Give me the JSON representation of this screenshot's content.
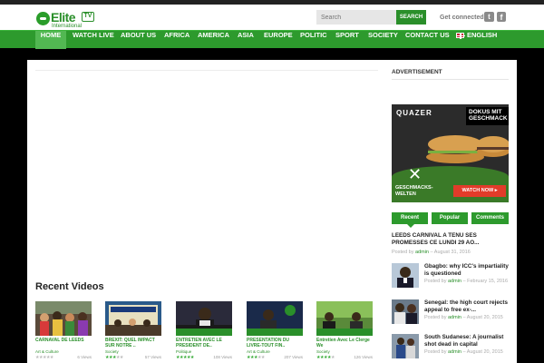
{
  "header": {
    "logo_text": "Elite",
    "logo_tv": "TV",
    "logo_sub": "International",
    "search_placeholder": "Search",
    "search_button": "SEARCH",
    "get_connected": "Get connected:",
    "twitter_icon": "twitter-icon",
    "facebook_icon": "facebook-icon"
  },
  "nav": {
    "items": [
      {
        "label": "HOME",
        "active": true
      },
      {
        "label": "WATCH LIVE"
      },
      {
        "label": "ABOUT US"
      },
      {
        "label": "AFRICA"
      },
      {
        "label": "AMERICA"
      },
      {
        "label": "ASIA"
      },
      {
        "label": "EUROPE"
      },
      {
        "label": "POLITIC"
      },
      {
        "label": "SPORT"
      },
      {
        "label": "SOCIETY"
      },
      {
        "label": "CONTACT US"
      },
      {
        "label": "ENGLISH"
      }
    ]
  },
  "main": {
    "recent_videos_title": "Recent Videos",
    "videos": [
      {
        "title": "CARNAVAL DE LEEDS",
        "category": "Art & Culture",
        "views": "6 Views"
      },
      {
        "title": "BREXIT: QUEL IMPACT SUR NOTRE ..",
        "category": "Society",
        "views": "57 Views"
      },
      {
        "title": "ENTRETIEN AVEC LE PRESIDENT DE..",
        "category": "Politique",
        "views": "108 Views"
      },
      {
        "title": "PRESENTATION DU LIVRE-TOUT FIN..",
        "category": "Art & Culture",
        "views": "207 Views"
      },
      {
        "title": "Entretien Avec Le Clerge We",
        "category": "Society",
        "views": "126 Views"
      }
    ]
  },
  "sidebar": {
    "advertisement_label": "ADVERTISEMENT",
    "ad": {
      "brand": "QUAZER",
      "badge": "DOKUS MIT GESCHMACK",
      "slogan_line1": "GESCHMACKS-",
      "slogan_line2": "WELTEN",
      "cta": "WATCH NOW ▸"
    },
    "tabs": [
      "Recent",
      "Popular",
      "Comments"
    ],
    "featured": {
      "title": "LEEDS CARNIVAL A TENU SES PROMESSES CE LUNDI 29 AO...",
      "posted_by": "Posted by",
      "author": "admin",
      "date": "August 31, 2016"
    },
    "items": [
      {
        "title": "Gbagbo: why ICC's impartiality is questioned",
        "posted_by": "Posted by",
        "author": "admin",
        "date": "February 15, 2016"
      },
      {
        "title": "Senegal: the high court rejects appeal to free ex-...",
        "posted_by": "Posted by",
        "author": "admin",
        "date": "August 20, 2015"
      },
      {
        "title": "South Sudanese: A journalist shot dead in capital",
        "posted_by": "Posted by",
        "author": "admin",
        "date": "August 20, 2015"
      }
    ]
  }
}
